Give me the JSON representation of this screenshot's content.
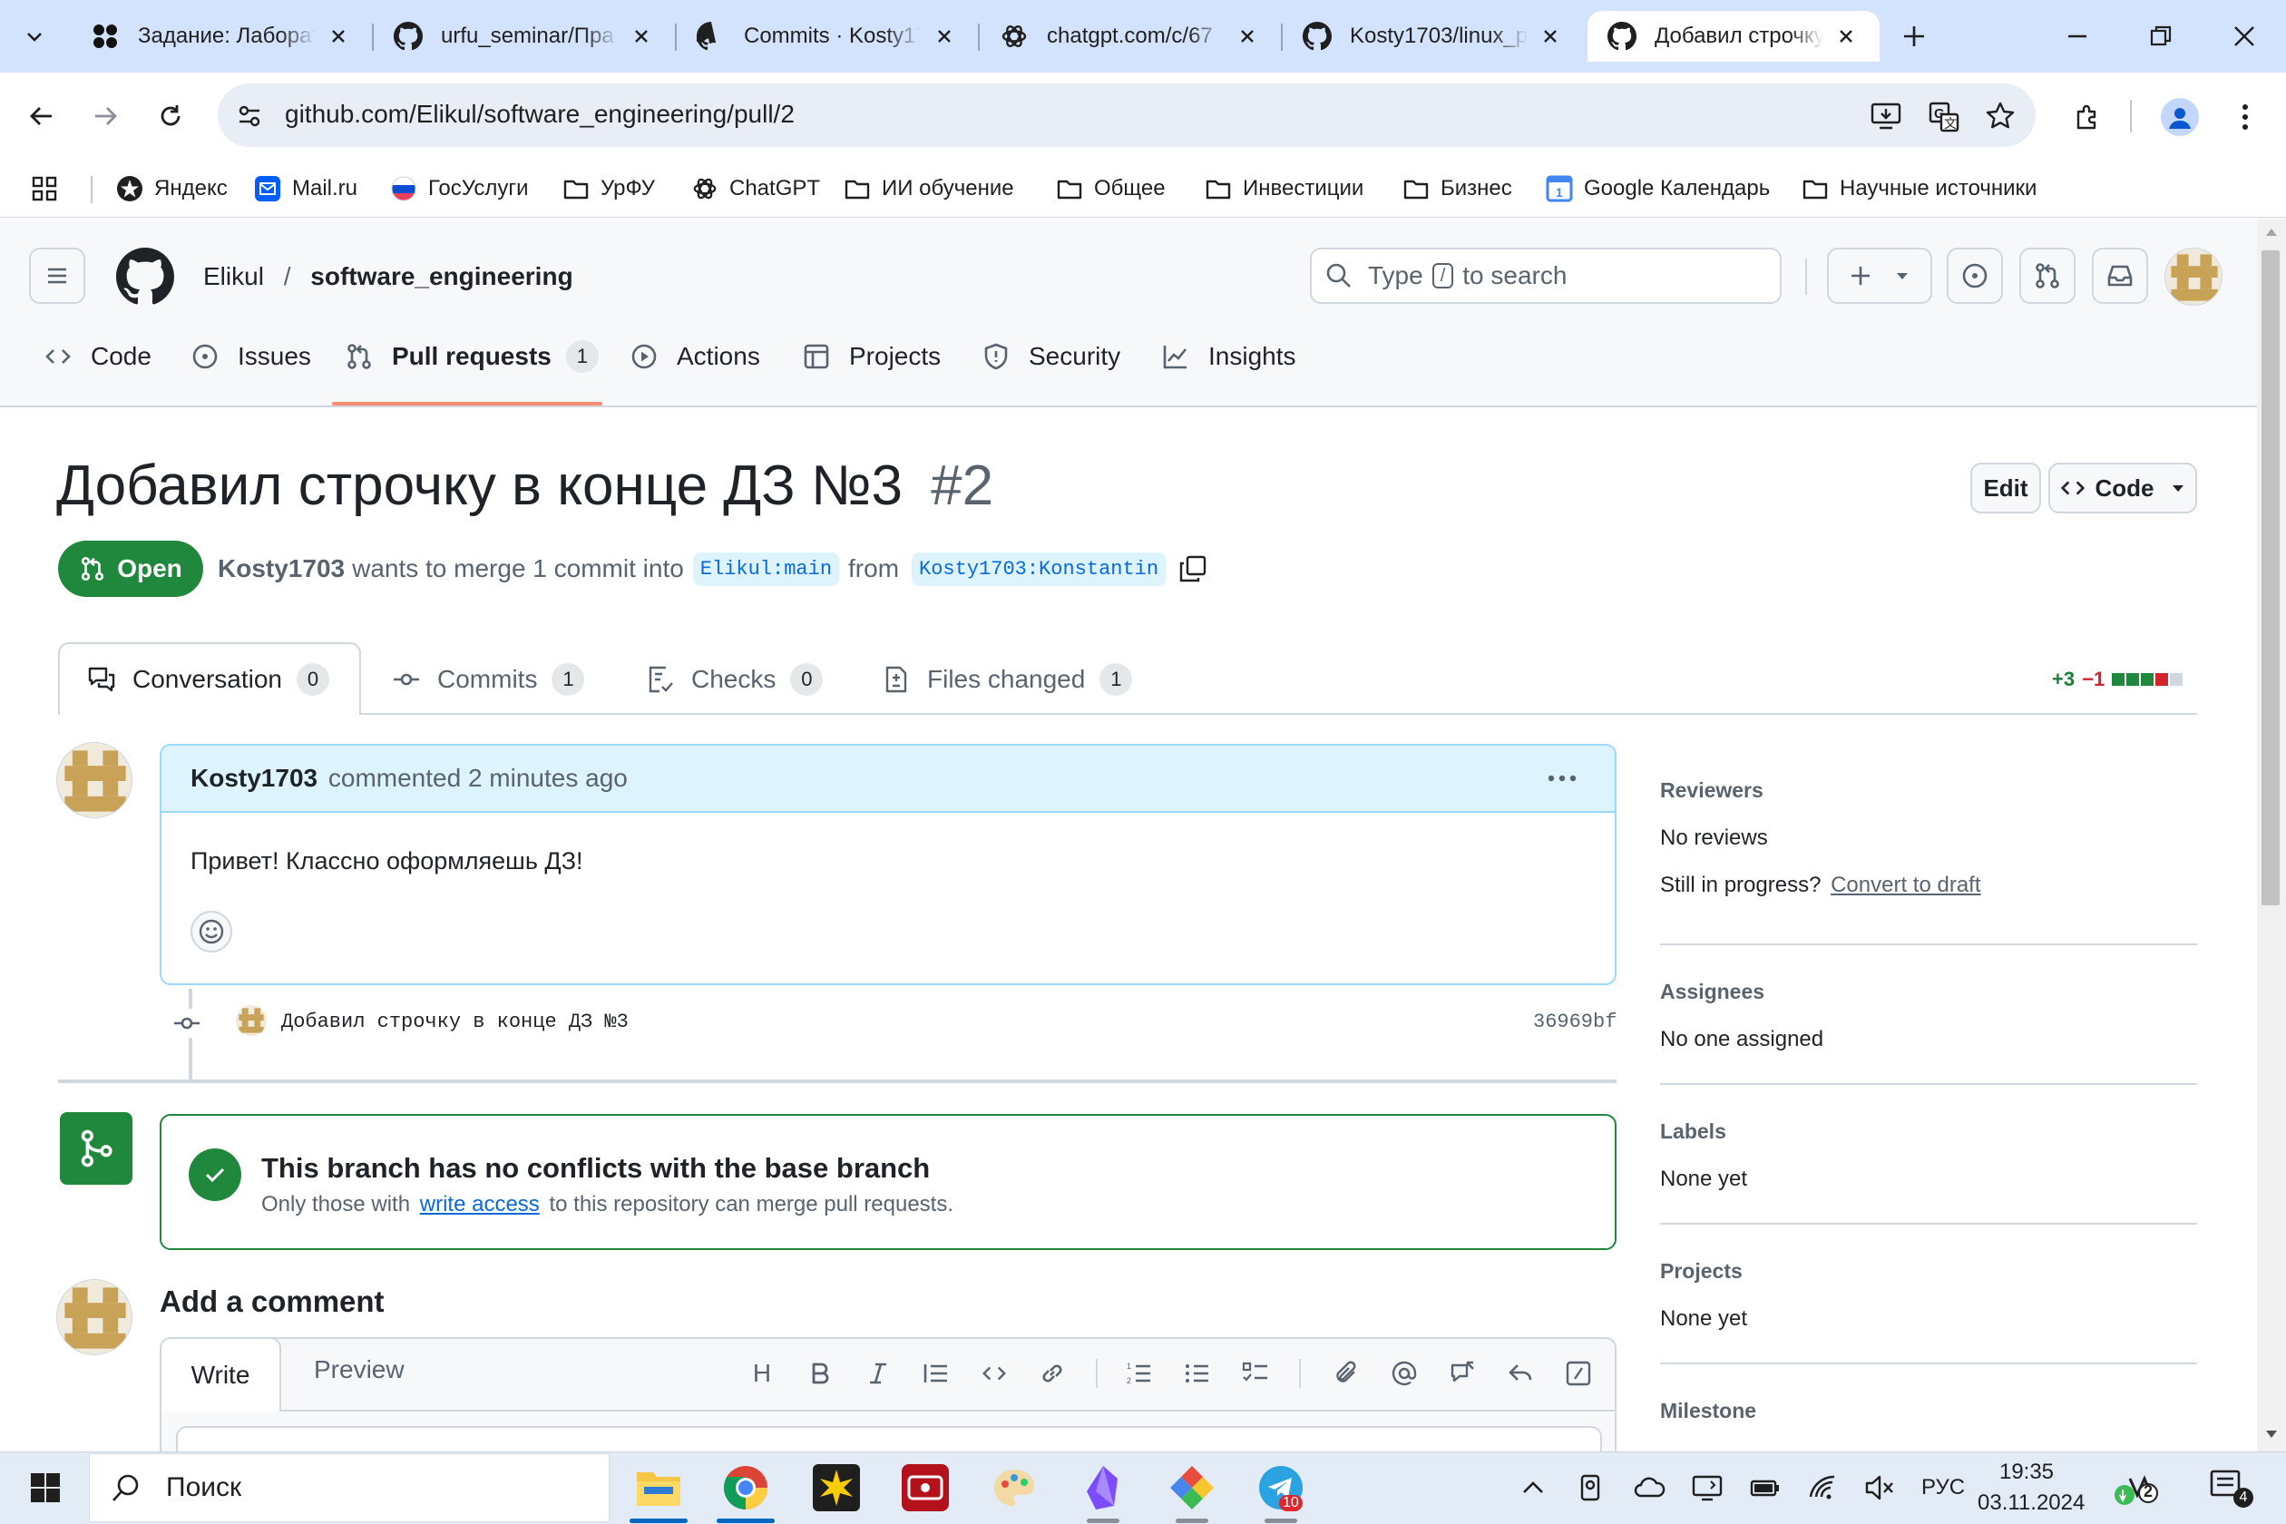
{
  "browser": {
    "tabs": [
      {
        "title": "Задание: Лаборат",
        "icon": "app-favicon"
      },
      {
        "title": "urfu_seminar/Пра",
        "icon": "github-icon"
      },
      {
        "title": "Commits · Kosty17",
        "icon": "github-icon"
      },
      {
        "title": "chatgpt.com/c/67",
        "icon": "chatgpt-icon"
      },
      {
        "title": "Kosty1703/linux_p",
        "icon": "github-icon"
      },
      {
        "title": "Добавил строчку",
        "icon": "github-icon"
      }
    ],
    "url": "github.com/Elikul/software_engineering/pull/2",
    "bookmarks": [
      "Яндекс",
      "Mail.ru",
      "ГосУслуги",
      "УрФУ",
      "ChatGPT",
      "ИИ обучение",
      "Общее",
      "Инвестиции",
      "Бизнес",
      "Google Календарь",
      "Научные источники"
    ]
  },
  "github": {
    "owner": "Elikul",
    "separator": "/",
    "repo": "software_engineering",
    "search": {
      "prefix": "Type",
      "key": "/",
      "suffix": "to search"
    },
    "repo_nav": [
      {
        "label": "Code"
      },
      {
        "label": "Issues"
      },
      {
        "label": "Pull requests",
        "count": "1"
      },
      {
        "label": "Actions"
      },
      {
        "label": "Projects"
      },
      {
        "label": "Security"
      },
      {
        "label": "Insights"
      }
    ]
  },
  "pr": {
    "title": "Добавил строчку в конце ДЗ №3",
    "number": "#2",
    "edit_label": "Edit",
    "code_label": "Code",
    "state": "Open",
    "author": "Kosty1703",
    "merge_text": "wants to merge 1 commit into",
    "base_branch": "Elikul:main",
    "from_text": "from",
    "head_branch": "Kosty1703:Konstantin",
    "tabs": [
      {
        "label": "Conversation",
        "count": "0"
      },
      {
        "label": "Commits",
        "count": "1"
      },
      {
        "label": "Checks",
        "count": "0"
      },
      {
        "label": "Files changed",
        "count": "1"
      }
    ],
    "additions": "+3",
    "deletions": "−1",
    "comment": {
      "author": "Kosty1703",
      "meta": "commented 2 minutes ago",
      "body": "Привет! Классно оформляешь ДЗ!"
    },
    "commit": {
      "message": "Добавил строчку в конце ДЗ №3",
      "sha": "36969bf"
    },
    "merge_box": {
      "title": "This branch has no conflicts with the base branch",
      "prefix": "Only those with",
      "link": "write access",
      "suffix": "to this repository can merge pull requests."
    },
    "add_comment": {
      "heading": "Add a comment",
      "write_tab": "Write",
      "preview_tab": "Preview",
      "toolbar_heading": "H"
    }
  },
  "sidebar": {
    "reviewers": {
      "heading": "Reviewers",
      "value": "No reviews",
      "progress_prefix": "Still in progress?",
      "progress_link": "Convert to draft"
    },
    "assignees": {
      "heading": "Assignees",
      "value": "No one assigned"
    },
    "labels": {
      "heading": "Labels",
      "value": "None yet"
    },
    "projects": {
      "heading": "Projects",
      "value": "None yet"
    },
    "milestone": {
      "heading": "Milestone"
    }
  },
  "taskbar": {
    "search_label": "Поиск",
    "language": "РУС",
    "time": "19:35",
    "date": "03.11.2024",
    "telegram_badge": "10",
    "notif_count": "4",
    "copilot_count": "2"
  },
  "colors": {
    "accent_green": "#1f883d",
    "link_blue": "#0969da",
    "tab_active_underline": "#fd8c73",
    "comment_header": "#ddf4ff"
  }
}
